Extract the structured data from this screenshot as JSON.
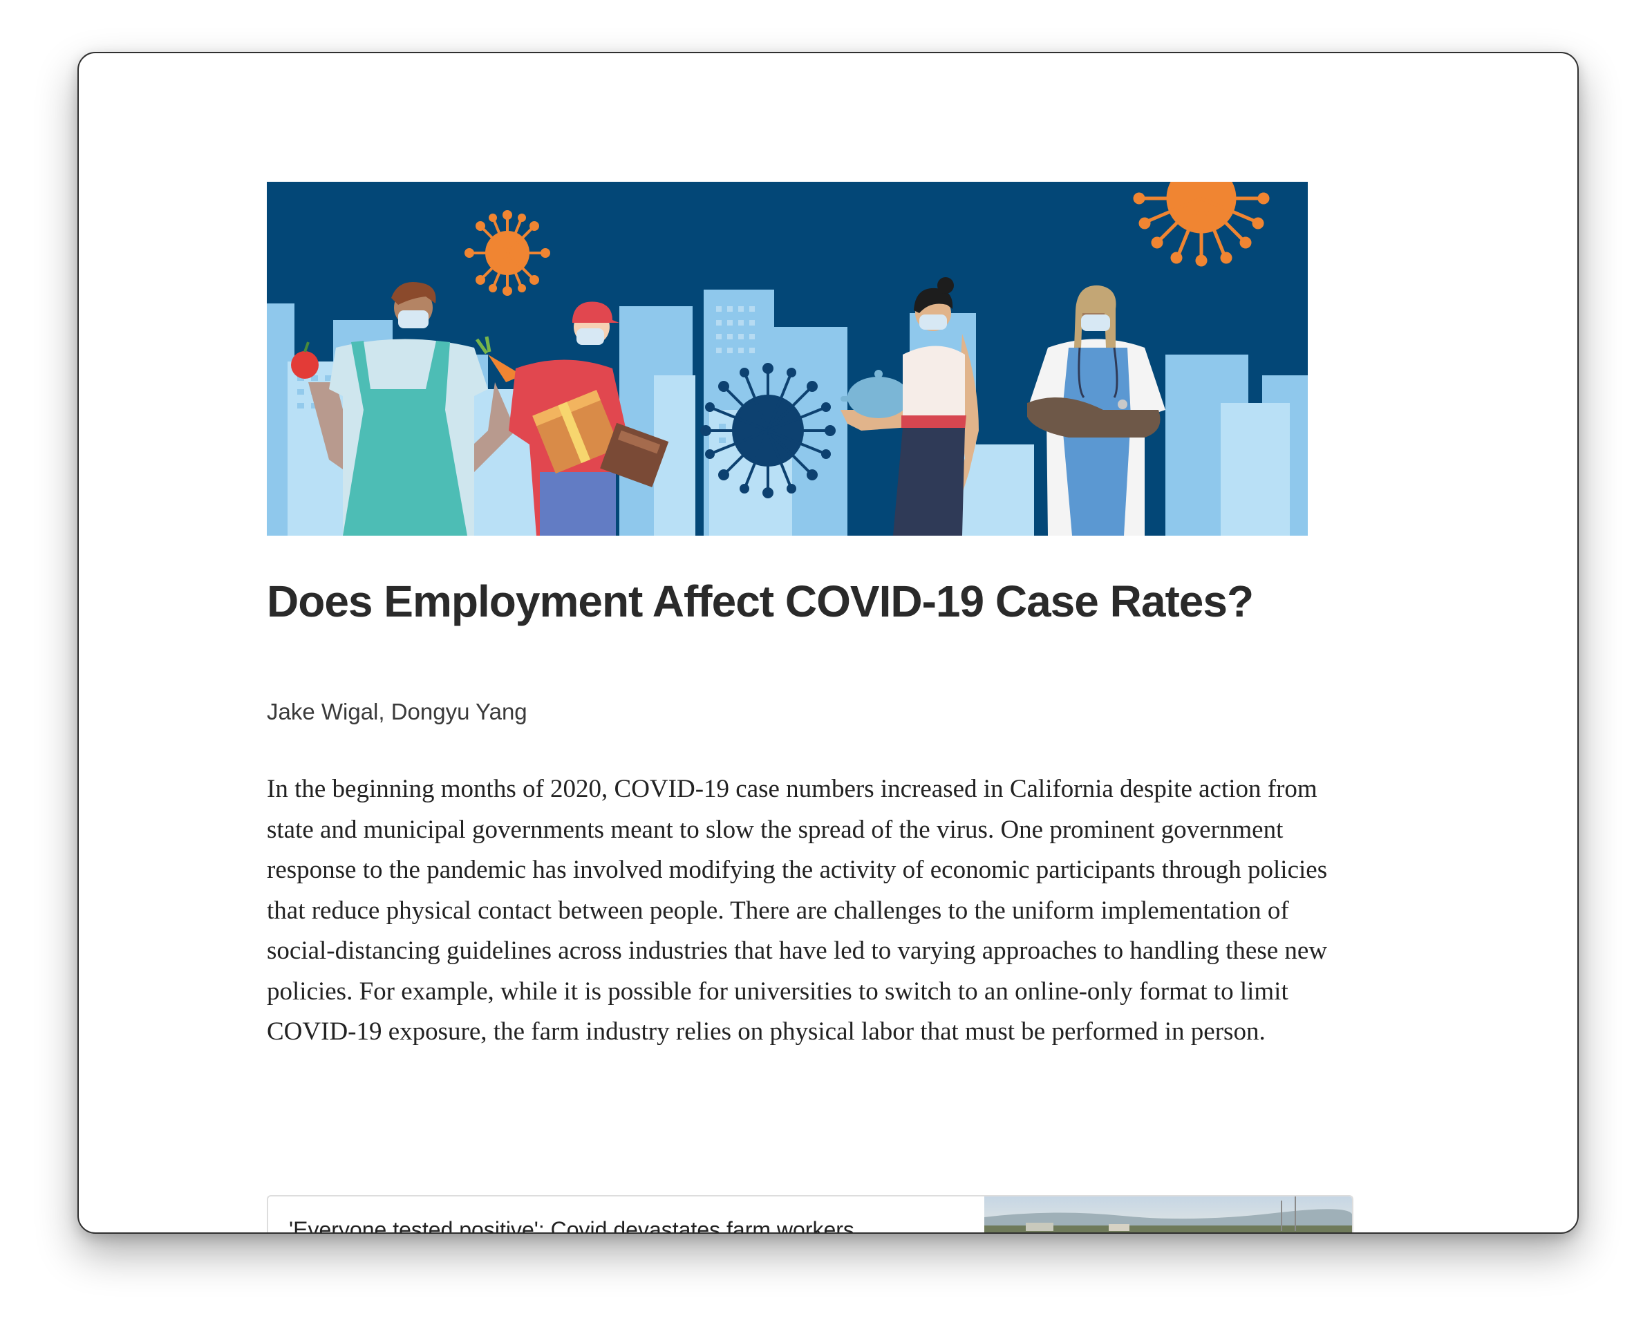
{
  "article": {
    "title": "Does Employment Affect COVID-19 Case Rates?",
    "authors": "Jake Wigal, Dongyu Yang",
    "paragraph": "In the beginning months of 2020, COVID-19 case numbers increased in California despite action from state and municipal governments meant to slow the spread of the virus. One prominent government response to the pandemic has involved modifying the activity of economic participants through policies that reduce physical contact between people. There are challenges to the uniform implementation of social-distancing guidelines across industries that have led to varying approaches to handling these new policies. For example, while it is possible for universities to switch to an online-only format to limit COVID-19 exposure, the farm industry relies on physical labor that must be performed in person."
  },
  "link_card": {
    "title": "'Everyone tested positive': Covid devastates farm workers"
  },
  "colors": {
    "hero_sky": "#034777",
    "virus_orange": "#f08532",
    "virus_navy": "#0d4170",
    "building_light": "#b9e0f6",
    "building_mid": "#8fc8ec",
    "text": "#222222"
  }
}
